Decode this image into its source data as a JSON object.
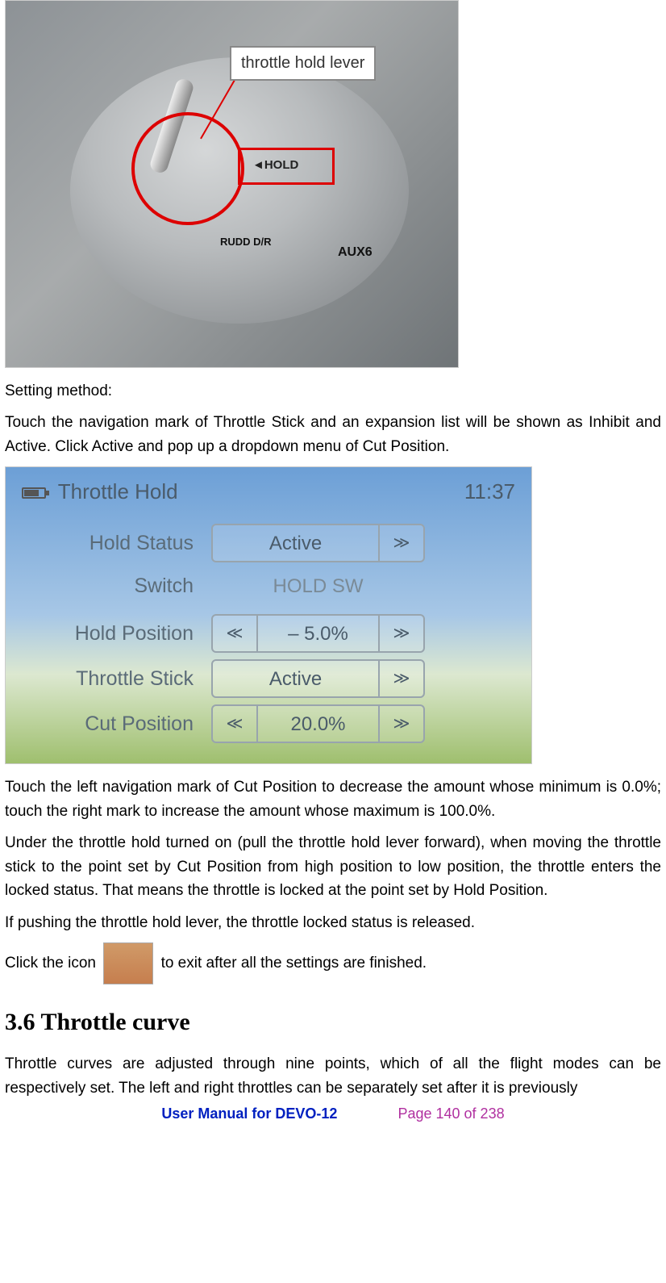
{
  "figure1": {
    "callout": "throttle hold lever",
    "hold_box_label": "◄HOLD",
    "aux_label": "AUX6",
    "rudd_label": "RUDD\nD/R"
  },
  "text": {
    "setting_method": "Setting method:",
    "p1": "Touch the navigation mark of Throttle Stick and an expansion list will be shown as Inhibit and Active. Click Active and pop up a dropdown menu of Cut Position.",
    "p2": "Touch the left navigation mark of Cut Position to decrease the amount whose minimum is 0.0%; touch the right mark to increase the amount whose maximum is 100.0%.",
    "p3": "Under the throttle hold turned on (pull the throttle hold lever forward), when moving the throttle stick to the point set by Cut Position from high position to low position, the throttle enters the locked status. That means the throttle is locked at the point set by Hold Position.",
    "p4": "If pushing the throttle hold lever, the throttle locked status is released.",
    "p5a": "Click the icon ",
    "p5b": " to exit after all the settings are finished.",
    "h_section": "3.6 Throttle curve",
    "p6": "Throttle curves are adjusted through nine points, which of all the flight modes can be respectively set. The left and right throttles can be separately set after it is previously"
  },
  "figure2": {
    "title": "Throttle Hold",
    "time": "11:37",
    "rows": {
      "hold_status": {
        "label": "Hold Status",
        "value": "Active"
      },
      "switch": {
        "label": "Switch",
        "value": "HOLD SW"
      },
      "hold_position": {
        "label": "Hold Position",
        "value": "–   5.0%"
      },
      "throttle_stick": {
        "label": "Throttle Stick",
        "value": "Active"
      },
      "cut_position": {
        "label": "Cut Position",
        "value": "20.0%"
      }
    },
    "nav": {
      "left": "≪",
      "right": "≫"
    }
  },
  "footer": {
    "title": "User Manual for DEVO-12",
    "page": "Page 140 of 238"
  }
}
